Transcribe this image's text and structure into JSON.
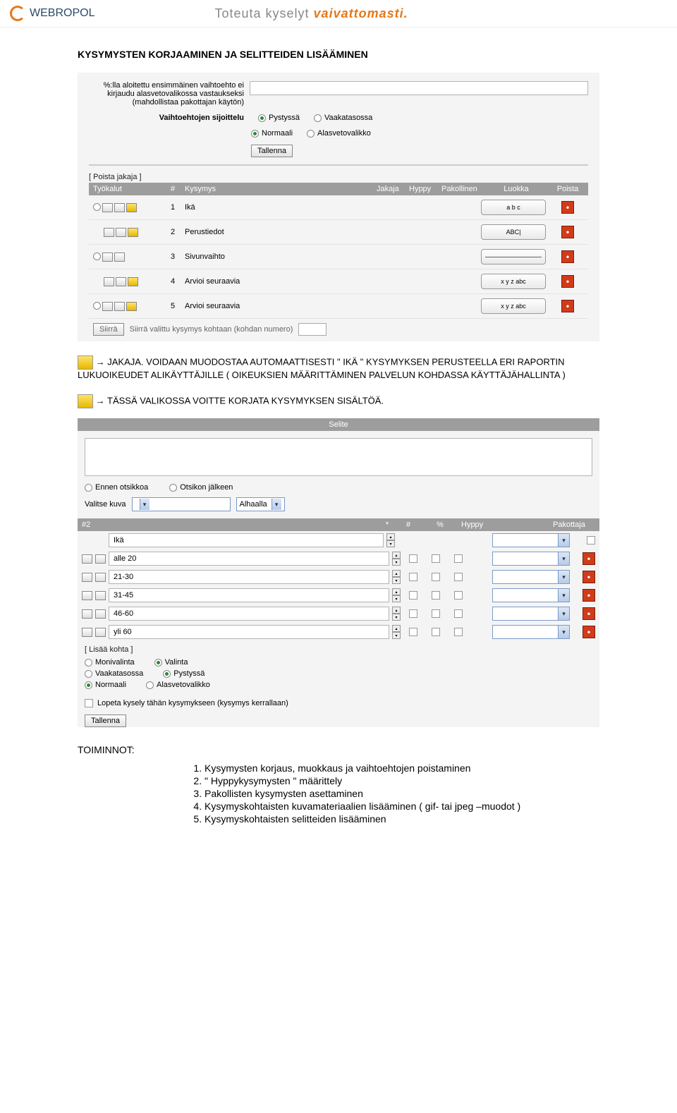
{
  "header": {
    "brand": "WEBROPOL",
    "tagline_gray": "Toteuta kyselyt",
    "tagline_orange": "vaivattomasti."
  },
  "section_title": "KYSYMYSTEN KORJAAMINEN JA SELITTEIDEN LISÄÄMINEN",
  "form1": {
    "pct_text": "%:lla aloitettu ensimmäinen vaihtoehto ei kirjaudu alasvetovalikossa vastaukseksi (mahdollistaa pakottajan käytön)",
    "sijoittelu_label": "Vaihtoehtojen sijoittelu",
    "pystyssa": "Pystyssä",
    "vaakatasossa": "Vaakatasossa",
    "normaali": "Normaali",
    "alasveto": "Alasvetovalikko",
    "tallenna": "Tallenna"
  },
  "poista_jakaja": "[ Poista jakaja ]",
  "grid": {
    "headers": {
      "tyokalut": "Työkalut",
      "hash": "#",
      "kysymys": "Kysymys",
      "jakaja": "Jakaja",
      "hyppy": "Hyppy",
      "pakollinen": "Pakollinen",
      "luokka": "Luokka",
      "poista": "Poista"
    },
    "rows": [
      {
        "num": "1",
        "label": "Ikä",
        "has_circle": true,
        "has_edit": true,
        "luokka_text": "a   b   c"
      },
      {
        "num": "2",
        "label": "Perustiedot",
        "has_circle": false,
        "has_edit": true,
        "luokka_text": "ABC|"
      },
      {
        "num": "3",
        "label": "Sivunvaihto",
        "has_circle": true,
        "has_edit": false,
        "luokka_text": ""
      },
      {
        "num": "4",
        "label": "Arvioi seuraavia",
        "has_circle": false,
        "has_edit": true,
        "luokka_text": "x  y  z\nabc"
      },
      {
        "num": "5",
        "label": "Arvioi seuraavia",
        "has_circle": true,
        "has_edit": true,
        "luokka_text": "x  y  z\nabc"
      }
    ],
    "siirra": "Siirrä",
    "siirra_text": "Siirrä valittu kysymys kohtaan (kohdan numero)"
  },
  "para1": "→ JAKAJA. VOIDAAN MUODOSTAA AUTOMAATTISESTI \" IKÄ \" KYSYMYKSEN PERUSTEELLA ERI RAPORTIN LUKUOIKEUDET ALIKÄYTTÄJILLE ( OIKEUKSIEN MÄÄRITTÄMINEN PALVELUN KOHDASSA KÄYTTÄJÄHALLINTA )",
  "para2": "→ TÄSSÄ VALIKOSSA VOITTE KORJATA KYSYMYKSEN SISÄLTÖÄ.",
  "selite": {
    "title": "Selite",
    "ennen": "Ennen otsikkoa",
    "jalkeen": "Otsikon jälkeen",
    "valitse_kuva": "Valitse kuva",
    "alhaalla": "Alhaalla",
    "header_main": "#2",
    "header_star": "*",
    "header_hash": "#",
    "header_pct": "%",
    "header_hyppy": "Hyppy",
    "header_pak": "Pakottaja",
    "options": [
      {
        "value": "Ikä",
        "no_boxes": true
      },
      {
        "value": "alle 20"
      },
      {
        "value": "21-30"
      },
      {
        "value": "31-45"
      },
      {
        "value": "46-60"
      },
      {
        "value": "yli 60"
      }
    ],
    "lisaa_kohta": "[ Lisää kohta ]",
    "monivalinta": "Monivalinta",
    "valinta": "Valinta",
    "vaakatasossa": "Vaakatasossa",
    "pystyssa": "Pystyssä",
    "normaali": "Normaali",
    "alasveto": "Alasvetovalikko",
    "lopeta": "Lopeta kysely tähän kysymykseen (kysymys kerrallaan)",
    "tallenna": "Tallenna"
  },
  "toiminnot": {
    "title": "TOIMINNOT:",
    "items": [
      "Kysymysten korjaus, muokkaus ja vaihtoehtojen poistaminen",
      "\" Hyppykysymysten \" määrittely",
      "Pakollisten kysymysten asettaminen",
      "Kysymyskohtaisten kuvamateriaalien lisääminen ( gif- tai jpeg –muodot )",
      "Kysymyskohtaisten selitteiden lisääminen"
    ]
  }
}
